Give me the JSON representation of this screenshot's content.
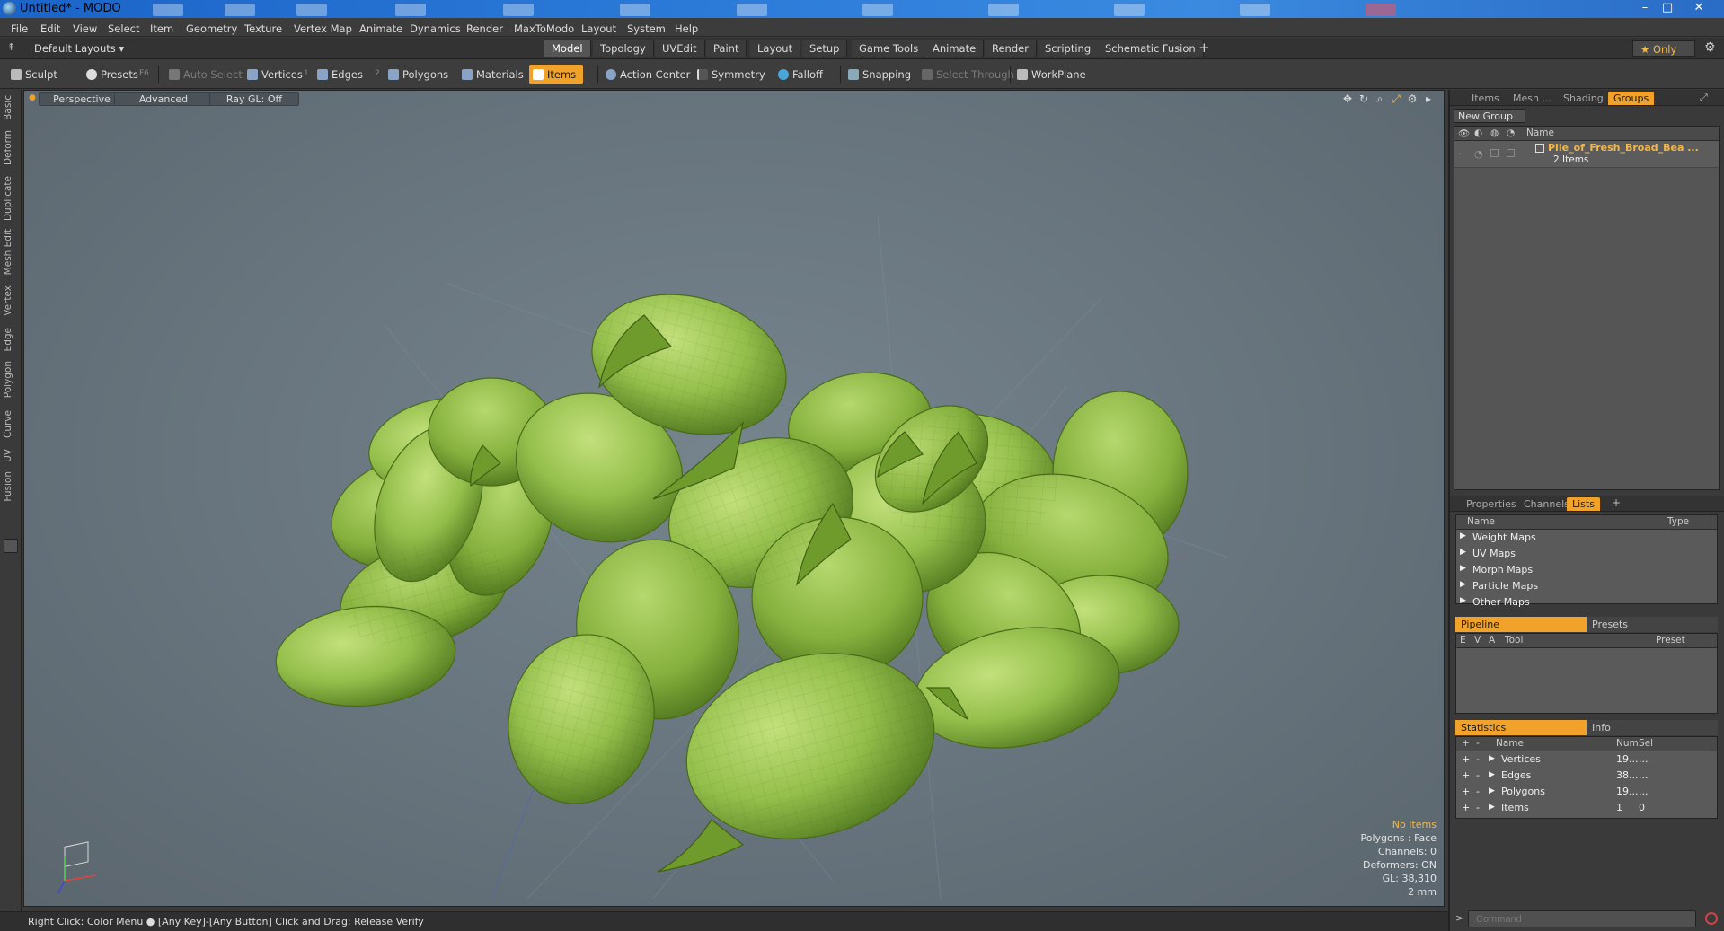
{
  "window": {
    "title": "Untitled* - MODO",
    "min": "–",
    "restore": "□",
    "close": "✕"
  },
  "menu": [
    "File",
    "Edit",
    "View",
    "Select",
    "Item",
    "Geometry",
    "Texture",
    "Vertex Map",
    "Animate",
    "Dynamics",
    "Render",
    "MaxToModo",
    "Layout",
    "System",
    "Help"
  ],
  "layouts": {
    "default_label": "Default Layouts ▾",
    "tabs": [
      "Model",
      "Topology",
      "UVEdit",
      "Paint",
      "Layout",
      "Setup",
      "Game Tools",
      "Animate",
      "Render",
      "Scripting",
      "Schematic Fusion"
    ],
    "active": "Model",
    "add": "+",
    "only_label": "★ Only"
  },
  "toolbar": {
    "sculpt": "Sculpt",
    "presets": "Presets",
    "presets_key": "F6",
    "auto_select": "Auto Select",
    "vertices": "Vertices",
    "vertices_num": "1",
    "edges": "Edges",
    "edges_num": "2",
    "polygons": "Polygons",
    "materials": "Materials",
    "items": "Items",
    "action_center": "Action Center",
    "symmetry": "Symmetry",
    "falloff": "Falloff",
    "snapping": "Snapping",
    "select_through": "Select Through",
    "workplane": "WorkPlane"
  },
  "left_tabs": [
    "Basic",
    "Deform",
    "Duplicate",
    "Mesh Edit",
    "Vertex",
    "Edge",
    "Polygon",
    "Curve",
    "UV",
    "Fusion"
  ],
  "viewport": {
    "perspective": "Perspective",
    "advanced": "Advanced",
    "raygl": "Ray GL: Off",
    "info": {
      "no_items": "No Items",
      "polygons": "Polygons : Face",
      "channels": "Channels: 0",
      "deformers": "Deformers: ON",
      "gl": "GL: 38,310",
      "scale": "2 mm"
    }
  },
  "status": {
    "text": "Right Click: Color Menu ● [Any Key]-[Any Button] Click and Drag: Release Verify"
  },
  "groups_panel": {
    "tabs": [
      "Items",
      "Mesh ...",
      "Shading",
      "Groups"
    ],
    "active": "Groups",
    "new_group": "New Group",
    "col_name": "Name",
    "group_name": "Pile_of_Fresh_Broad_Bea ...",
    "group_count": "2 Items"
  },
  "lists_panel": {
    "tabs": [
      "Properties",
      "Channels",
      "Lists"
    ],
    "active": "Lists",
    "add": "+",
    "col_name": "Name",
    "col_type": "Type",
    "rows": [
      "Weight Maps",
      "UV Maps",
      "Morph Maps",
      "Particle Maps",
      "Other Maps"
    ]
  },
  "pipeline_panel": {
    "tab_active": "Pipeline",
    "tab_other": "Presets",
    "cols": {
      "e": "E",
      "v": "V",
      "a": "A",
      "tool": "Tool",
      "preset": "Preset"
    }
  },
  "stats_panel": {
    "tab_active": "Statistics",
    "tab_other": "Info",
    "cols": {
      "plus": "+",
      "minus": "-",
      "name": "Name",
      "num": "Num",
      "sel": "Sel"
    },
    "rows": [
      {
        "name": "Vertices",
        "num": "19...",
        "sel": "..."
      },
      {
        "name": "Edges",
        "num": "38...",
        "sel": "..."
      },
      {
        "name": "Polygons",
        "num": "19...",
        "sel": "..."
      },
      {
        "name": "Items",
        "num": "1",
        "sel": "0"
      }
    ]
  },
  "command": {
    "placeholder": "Command"
  },
  "colors": {
    "accent": "#f0a22a",
    "viewport": "#6b7880",
    "bean_light": "#a9d064",
    "bean_dark": "#5f8a2a"
  }
}
